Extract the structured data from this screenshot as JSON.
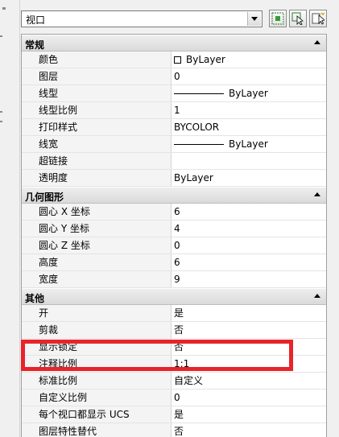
{
  "toolbar": {
    "selector_value": "视口",
    "buttons": [
      {
        "name": "quick-select-icon"
      },
      {
        "name": "select-objects-icon"
      },
      {
        "name": "toggle-pickadd-icon"
      }
    ]
  },
  "sections": [
    {
      "title": "常规",
      "rows": [
        {
          "name": "颜色",
          "value": "ByLayer",
          "adornment": "swatch"
        },
        {
          "name": "图层",
          "value": "0"
        },
        {
          "name": "线型",
          "value": "ByLayer",
          "adornment": "line"
        },
        {
          "name": "线型比例",
          "value": "1"
        },
        {
          "name": "打印样式",
          "value": "BYCOLOR"
        },
        {
          "name": "线宽",
          "value": "ByLayer",
          "adornment": "line"
        },
        {
          "name": "超链接",
          "value": ""
        },
        {
          "name": "透明度",
          "value": "ByLayer"
        }
      ]
    },
    {
      "title": "几何图形",
      "rows": [
        {
          "name": "圆心 X 坐标",
          "value": "6"
        },
        {
          "name": "圆心 Y 坐标",
          "value": "4"
        },
        {
          "name": "圆心 Z 坐标",
          "value": "0"
        },
        {
          "name": "高度",
          "value": "6"
        },
        {
          "name": "宽度",
          "value": "9"
        }
      ]
    },
    {
      "title": "其他",
      "rows": [
        {
          "name": "开",
          "value": "是"
        },
        {
          "name": "剪裁",
          "value": "否"
        },
        {
          "name": "显示锁定",
          "value": "否"
        },
        {
          "name": "注释比例",
          "value": "1:1"
        },
        {
          "name": "标准比例",
          "value": "自定义"
        },
        {
          "name": "自定义比例",
          "value": "0"
        },
        {
          "name": "每个视口都显示 UCS",
          "value": "是"
        },
        {
          "name": "图层特性替代",
          "value": "否"
        }
      ]
    }
  ],
  "colors": {
    "highlight": "#e8242b",
    "section_header": "#dadada",
    "name_cell": "#f4f4f4"
  }
}
